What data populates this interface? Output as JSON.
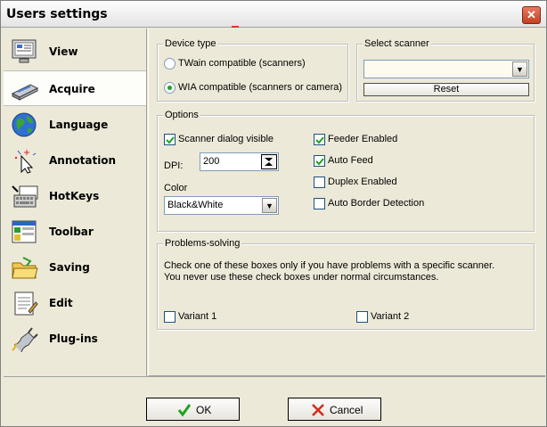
{
  "window": {
    "title": "Users settings"
  },
  "sidebar": {
    "items": [
      {
        "label": "View",
        "icon": "monitor-icon"
      },
      {
        "label": "Acquire",
        "icon": "scanner-icon",
        "active": true
      },
      {
        "label": "Language",
        "icon": "globe-icon"
      },
      {
        "label": "Annotation",
        "icon": "cursor-sparkle-icon"
      },
      {
        "label": "HotKeys",
        "icon": "keyboard-icon"
      },
      {
        "label": "Toolbar",
        "icon": "toolbar-icon"
      },
      {
        "label": "Saving",
        "icon": "folder-icon"
      },
      {
        "label": "Edit",
        "icon": "notepad-icon"
      },
      {
        "label": "Plug-ins",
        "icon": "plug-icon"
      }
    ]
  },
  "device_type": {
    "legend": "Device type",
    "option1": "TWain compatible (scanners)",
    "option2": "WIA compatible (scanners or camera)",
    "selected": "option2"
  },
  "select_scanner": {
    "legend": "Select scanner",
    "value": "",
    "reset_label": "Reset"
  },
  "options": {
    "legend": "Options",
    "scanner_dialog_visible": "Scanner dialog visible",
    "dpi_label": "DPI:",
    "dpi_value": "200",
    "color_label": "Color",
    "color_value": "Black&White",
    "feeder_enabled": "Feeder Enabled",
    "auto_feed": "Auto Feed",
    "duplex_enabled": "Duplex Enabled",
    "auto_border_detection": "Auto Border Detection"
  },
  "problems": {
    "legend": "Problems-solving",
    "line1": "Check one of these boxes only if you have problems with a specific scanner.",
    "line2": "You never use these check boxes under normal circumstances.",
    "variant1": "Variant 1",
    "variant2": "Variant 2"
  },
  "footer": {
    "ok_label": "OK",
    "cancel_label": "Cancel"
  },
  "colors": {
    "background": "#ece9d8",
    "check_green": "#21a121",
    "cancel_red": "#d42a1a"
  }
}
